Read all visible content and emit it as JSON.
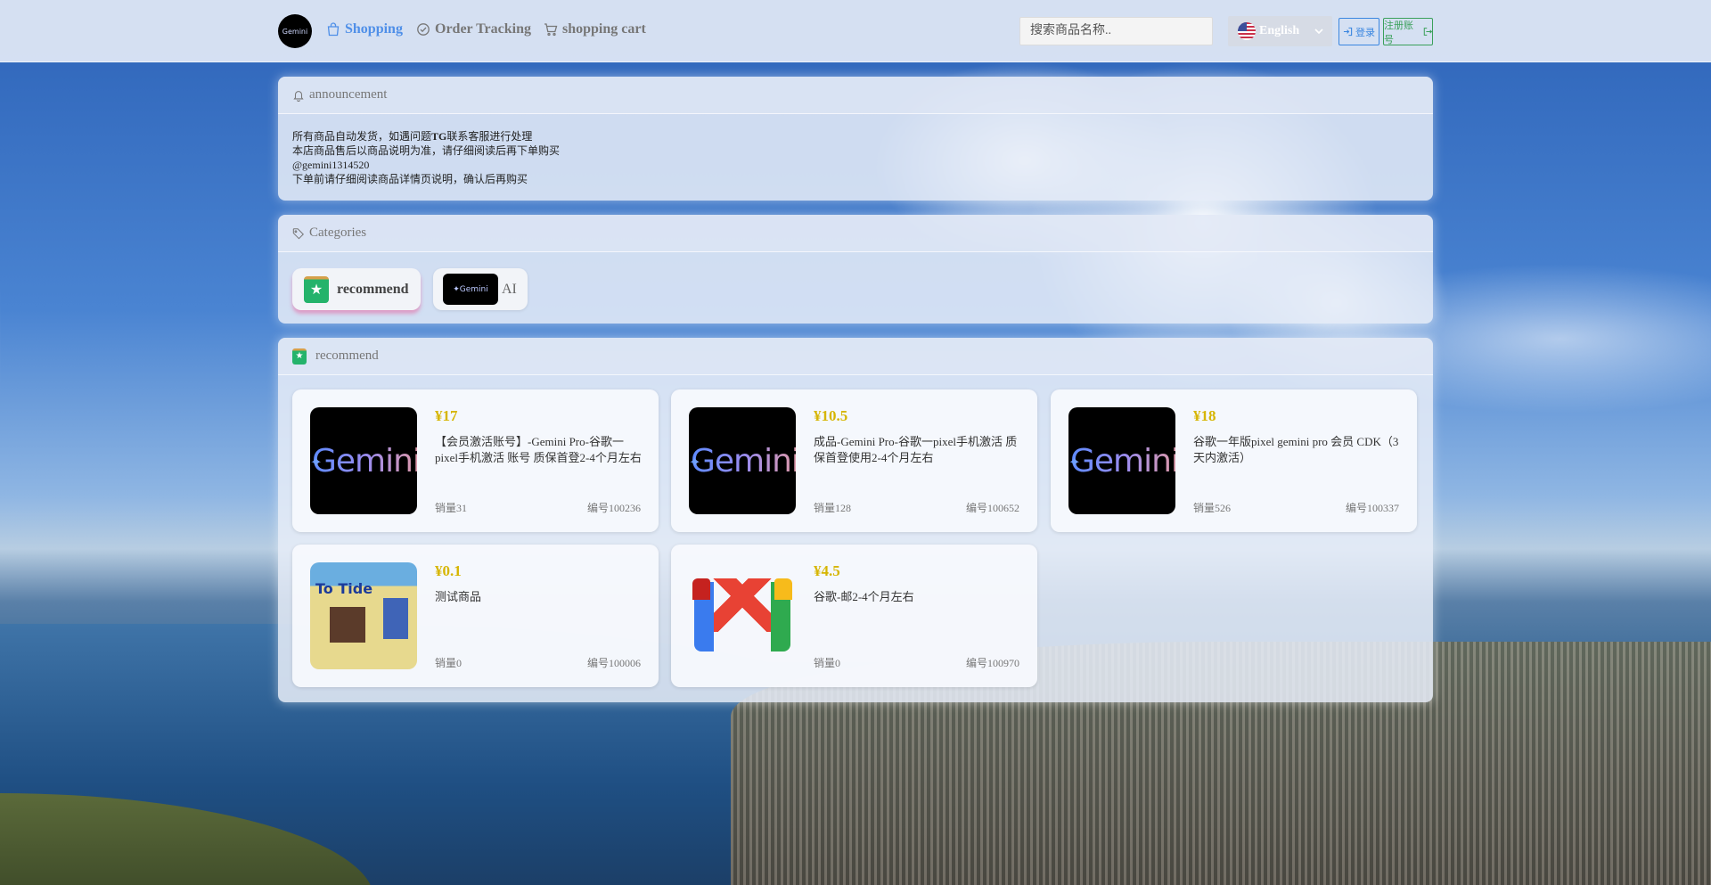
{
  "nav": {
    "logo_text": "Gemini",
    "links": [
      {
        "label": "Shopping"
      },
      {
        "label": "Order Tracking"
      },
      {
        "label": "shopping cart"
      }
    ],
    "search_placeholder": "搜索商品名称..",
    "language": "English",
    "login_label": "登录",
    "register_label": "注册账号"
  },
  "announcement": {
    "title": "announcement",
    "lines": [
      {
        "pre": "所有商品自动发货，如遇问题",
        "bold": "TG",
        "post": "联系客服进行处理"
      },
      {
        "pre": "本店商品售后以商品说明为准，请仔细阅读后再下单购买",
        "bold": "",
        "post": ""
      },
      {
        "pre": "@gemini1314520",
        "bold": "",
        "post": ""
      },
      {
        "pre": "下单前请仔细阅读商品详情页说明，确认后再购买",
        "bold": "",
        "post": ""
      }
    ]
  },
  "categories": {
    "title": "Categories",
    "items": [
      {
        "label": "recommend"
      },
      {
        "label": "AI",
        "badge_text": "✦Gemini"
      }
    ]
  },
  "products": {
    "title": "recommend",
    "items": [
      {
        "price": "¥17",
        "title": "【会员激活账号】-Gemini Pro-谷歌一pixel手机激活 账号 质保首登2-4个月左右",
        "sold": "销量31",
        "id": "编号100236",
        "thumb": "gemini",
        "thumb_text": "Gemini"
      },
      {
        "price": "¥10.5",
        "title": "成品-Gemini Pro-谷歌一pixel手机激活 质保首登使用2-4个月左右",
        "sold": "销量128",
        "id": "编号100652",
        "thumb": "gemini",
        "thumb_text": "Gemini"
      },
      {
        "price": "¥18",
        "title": "谷歌一年版pixel gemini pro 会员 CDK（3天内激活）",
        "sold": "销量526",
        "id": "编号100337",
        "thumb": "gemini",
        "thumb_text": "Gemini"
      },
      {
        "price": "¥0.1",
        "title": "测试商品",
        "sold": "销量0",
        "id": "编号100006",
        "thumb": "totide",
        "thumb_text": "To Tide"
      },
      {
        "price": "¥4.5",
        "title": "谷歌-邮2-4个月左右",
        "sold": "销量0",
        "id": "编号100970",
        "thumb": "gmail",
        "thumb_text": ""
      }
    ]
  },
  "colors": {
    "accent": "#4f8fe8",
    "price": "#d6b500",
    "login": "#3a86e0",
    "register": "#3aa05a"
  }
}
